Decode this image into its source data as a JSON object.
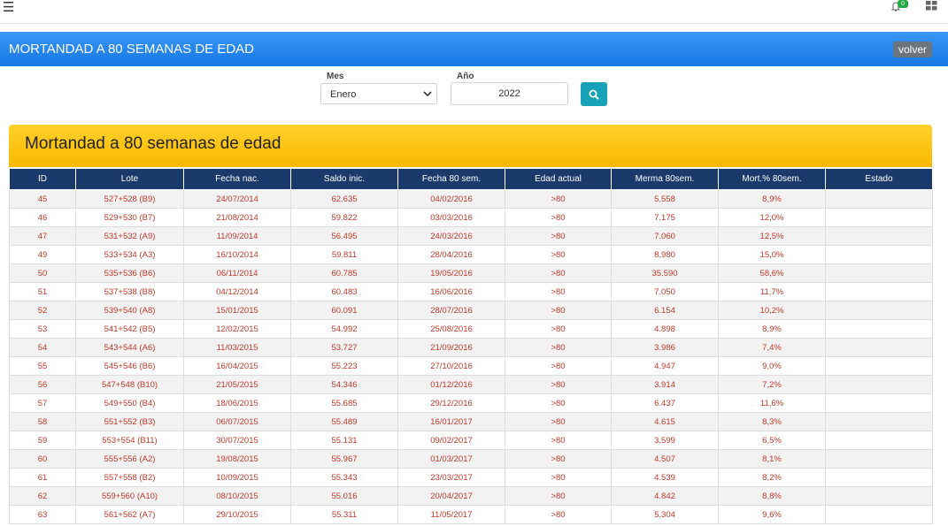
{
  "topbar": {
    "menu_icon": "hamburger-icon",
    "notifications": {
      "icon": "bell-icon",
      "count": "0"
    },
    "apps_icon": "grid-icon"
  },
  "header": {
    "title": "MORTANDAD A 80 SEMANAS DE EDAD",
    "back_label": "volver"
  },
  "filters": {
    "month_label": "Mes",
    "month_value": "Enero",
    "year_label": "Año",
    "year_value": "2022",
    "search_icon": "search-icon"
  },
  "panel": {
    "title": "Mortandad a 80 semanas de edad"
  },
  "colors": {
    "header_blue": "#1677e4",
    "panel_yellow": "#f9b800",
    "table_head": "#1a3a6b",
    "cell_text": "#c0392b",
    "search_btn": "#17a2b8"
  },
  "table": {
    "columns": [
      "ID",
      "Lote",
      "Fecha nac.",
      "Saldo inic.",
      "Fecha 80 sem.",
      "Edad actual",
      "Merma 80sem.",
      "Mort.% 80sem.",
      "Estado"
    ],
    "rows": [
      [
        "45",
        "527+528 (B9)",
        "24/07/2014",
        "62.635",
        "04/02/2016",
        ">80",
        "5.558",
        "8,9%",
        ""
      ],
      [
        "46",
        "529+530 (B7)",
        "21/08/2014",
        "59.822",
        "03/03/2016",
        ">80",
        "7.175",
        "12,0%",
        ""
      ],
      [
        "47",
        "531+532 (A9)",
        "11/09/2014",
        "56.495",
        "24/03/2016",
        ">80",
        "7.060",
        "12,5%",
        ""
      ],
      [
        "49",
        "533+534 (A3)",
        "16/10/2014",
        "59.811",
        "28/04/2016",
        ">80",
        "8.980",
        "15,0%",
        ""
      ],
      [
        "50",
        "535+536 (B6)",
        "06/11/2014",
        "60.785",
        "19/05/2016",
        ">80",
        "35.590",
        "58,6%",
        ""
      ],
      [
        "51",
        "537+538 (B8)",
        "04/12/2014",
        "60.483",
        "16/06/2016",
        ">80",
        "7.050",
        "11,7%",
        ""
      ],
      [
        "52",
        "539+540 (A8)",
        "15/01/2015",
        "60.091",
        "28/07/2016",
        ">80",
        "6.154",
        "10,2%",
        ""
      ],
      [
        "53",
        "541+542 (B5)",
        "12/02/2015",
        "54.992",
        "25/08/2016",
        ">80",
        "4.898",
        "8,9%",
        ""
      ],
      [
        "54",
        "543+544 (A6)",
        "11/03/2015",
        "53.727",
        "21/09/2016",
        ">80",
        "3.986",
        "7,4%",
        ""
      ],
      [
        "55",
        "545+546 (B6)",
        "16/04/2015",
        "55.223",
        "27/10/2016",
        ">80",
        "4.947",
        "9,0%",
        ""
      ],
      [
        "56",
        "547+548 (B10)",
        "21/05/2015",
        "54.346",
        "01/12/2016",
        ">80",
        "3.914",
        "7,2%",
        ""
      ],
      [
        "57",
        "549+550 (B4)",
        "18/06/2015",
        "55.685",
        "29/12/2016",
        ">80",
        "6.437",
        "11,6%",
        ""
      ],
      [
        "58",
        "551+552 (B3)",
        "06/07/2015",
        "55.489",
        "16/01/2017",
        ">80",
        "4.615",
        "8,3%",
        ""
      ],
      [
        "59",
        "553+554 (B11)",
        "30/07/2015",
        "55.131",
        "09/02/2017",
        ">80",
        "3.599",
        "6,5%",
        ""
      ],
      [
        "60",
        "555+556 (A2)",
        "19/08/2015",
        "55.967",
        "01/03/2017",
        ">80",
        "4.507",
        "8,1%",
        ""
      ],
      [
        "61",
        "557+558 (B2)",
        "10/09/2015",
        "55.343",
        "23/03/2017",
        ">80",
        "4.539",
        "8,2%",
        ""
      ],
      [
        "62",
        "559+560 (A10)",
        "08/10/2015",
        "55.016",
        "20/04/2017",
        ">80",
        "4.842",
        "8,8%",
        ""
      ],
      [
        "63",
        "561+562 (A7)",
        "29/10/2015",
        "55.311",
        "11/05/2017",
        ">80",
        "5.304",
        "9,6%",
        ""
      ]
    ]
  }
}
